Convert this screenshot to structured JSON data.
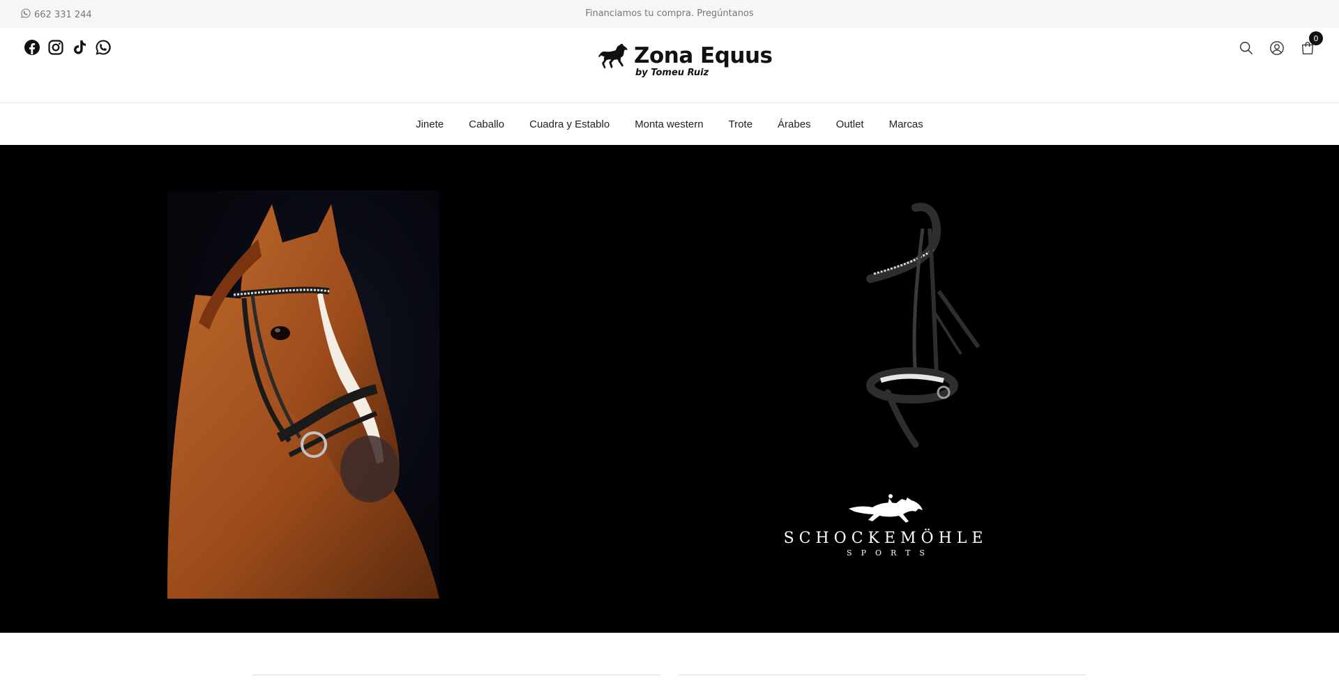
{
  "announcement": {
    "phone": "662 331 244",
    "promo": "Financiamos tu compra. Pregúntanos"
  },
  "header": {
    "socials": [
      "facebook-icon",
      "instagram-icon",
      "tiktok-icon",
      "whatsapp-icon"
    ],
    "logo": {
      "name": "Zona Equus",
      "subtitle": "by Tomeu Ruiz"
    },
    "actions": [
      "search-icon",
      "account-icon",
      "cart-icon"
    ],
    "cart_count": "0"
  },
  "nav": {
    "items": [
      "Jinete",
      "Caballo",
      "Cuadra y Establo",
      "Monta western",
      "Trote",
      "Árabes",
      "Outlet",
      "Marcas"
    ]
  },
  "hero": {
    "brand_name": "SCHOCKEMÖHLE",
    "brand_sub": "SPORTS",
    "background": "#000000"
  },
  "colors": {
    "topbar": "#f6f6f6",
    "text_muted": "#777777",
    "accent": "#111111"
  }
}
